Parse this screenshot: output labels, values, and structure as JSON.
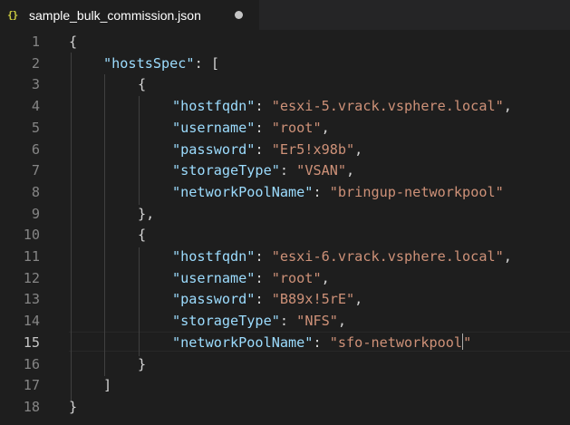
{
  "tab": {
    "icon_glyph": "{}",
    "icon_name": "json-file-icon",
    "title": "sample_bulk_commission.json",
    "dirty": true
  },
  "editor": {
    "active_line": 15,
    "colors": {
      "background": "#1e1e1e",
      "punctuation": "#d4d4d4",
      "key": "#9cdcfe",
      "string": "#ce9178",
      "line_number": "#858585"
    },
    "lines": [
      {
        "n": "1",
        "tokens": [
          {
            "t": "{",
            "c": "punc"
          }
        ]
      },
      {
        "n": "2",
        "tokens": [
          {
            "t": "\"hostsSpec\"",
            "c": "key"
          },
          {
            "t": ": [",
            "c": "punc"
          }
        ]
      },
      {
        "n": "3",
        "tokens": [
          {
            "t": "{",
            "c": "punc"
          }
        ]
      },
      {
        "n": "4",
        "tokens": [
          {
            "t": "\"hostfqdn\"",
            "c": "key"
          },
          {
            "t": ": ",
            "c": "punc"
          },
          {
            "t": "\"esxi-5.vrack.vsphere.local\"",
            "c": "str"
          },
          {
            "t": ",",
            "c": "punc"
          }
        ]
      },
      {
        "n": "5",
        "tokens": [
          {
            "t": "\"username\"",
            "c": "key"
          },
          {
            "t": ": ",
            "c": "punc"
          },
          {
            "t": "\"root\"",
            "c": "str"
          },
          {
            "t": ",",
            "c": "punc"
          }
        ]
      },
      {
        "n": "6",
        "tokens": [
          {
            "t": "\"password\"",
            "c": "key"
          },
          {
            "t": ": ",
            "c": "punc"
          },
          {
            "t": "\"Er5!x98b\"",
            "c": "str"
          },
          {
            "t": ",",
            "c": "punc"
          }
        ]
      },
      {
        "n": "7",
        "tokens": [
          {
            "t": "\"storageType\"",
            "c": "key"
          },
          {
            "t": ": ",
            "c": "punc"
          },
          {
            "t": "\"VSAN\"",
            "c": "str"
          },
          {
            "t": ",",
            "c": "punc"
          }
        ]
      },
      {
        "n": "8",
        "tokens": [
          {
            "t": "\"networkPoolName\"",
            "c": "key"
          },
          {
            "t": ": ",
            "c": "punc"
          },
          {
            "t": "\"bringup-networkpool\"",
            "c": "str"
          }
        ]
      },
      {
        "n": "9",
        "tokens": [
          {
            "t": "},",
            "c": "punc"
          }
        ]
      },
      {
        "n": "10",
        "tokens": [
          {
            "t": "{",
            "c": "punc"
          }
        ]
      },
      {
        "n": "11",
        "tokens": [
          {
            "t": "\"hostfqdn\"",
            "c": "key"
          },
          {
            "t": ": ",
            "c": "punc"
          },
          {
            "t": "\"esxi-6.vrack.vsphere.local\"",
            "c": "str"
          },
          {
            "t": ",",
            "c": "punc"
          }
        ]
      },
      {
        "n": "12",
        "tokens": [
          {
            "t": "\"username\"",
            "c": "key"
          },
          {
            "t": ": ",
            "c": "punc"
          },
          {
            "t": "\"root\"",
            "c": "str"
          },
          {
            "t": ",",
            "c": "punc"
          }
        ]
      },
      {
        "n": "13",
        "tokens": [
          {
            "t": "\"password\"",
            "c": "key"
          },
          {
            "t": ": ",
            "c": "punc"
          },
          {
            "t": "\"B89x!5rE\"",
            "c": "str"
          },
          {
            "t": ",",
            "c": "punc"
          }
        ]
      },
      {
        "n": "14",
        "tokens": [
          {
            "t": "\"storageType\"",
            "c": "key"
          },
          {
            "t": ": ",
            "c": "punc"
          },
          {
            "t": "\"NFS\"",
            "c": "str"
          },
          {
            "t": ",",
            "c": "punc"
          }
        ]
      },
      {
        "n": "15",
        "tokens": [
          {
            "t": "\"networkPoolName\"",
            "c": "key"
          },
          {
            "t": ": ",
            "c": "punc"
          },
          {
            "t": "\"sfo-networkpool",
            "c": "str"
          },
          {
            "t": "|cursor|",
            "c": "cursor"
          },
          {
            "t": "\"",
            "c": "str"
          }
        ]
      },
      {
        "n": "16",
        "tokens": [
          {
            "t": "}",
            "c": "punc"
          }
        ]
      },
      {
        "n": "17",
        "tokens": [
          {
            "t": "]",
            "c": "punc"
          }
        ]
      },
      {
        "n": "18",
        "tokens": [
          {
            "t": "}",
            "c": "punc"
          }
        ]
      }
    ]
  }
}
